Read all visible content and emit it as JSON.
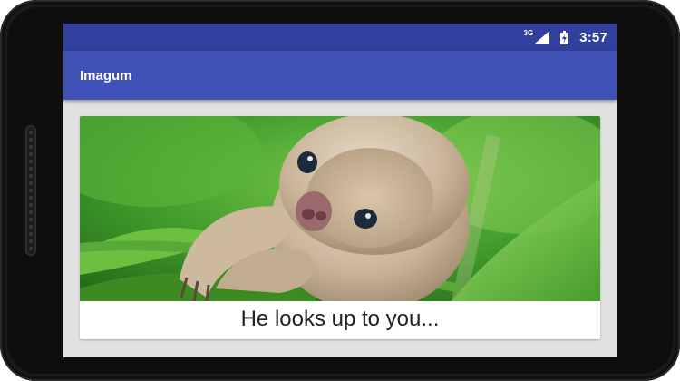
{
  "status_bar": {
    "network_type": "3G",
    "signal_icon": "cell-signal-icon",
    "battery_icon": "battery-charging-icon",
    "time": "3:57"
  },
  "app_bar": {
    "title": "Imagum",
    "color": "#3f51b5"
  },
  "card": {
    "image_subject": "sloth-photo",
    "caption": "He looks up to you..."
  },
  "colors": {
    "status_bar": "#30409c",
    "app_bar": "#3f51b5",
    "screen_background": "#e1e1e1"
  }
}
